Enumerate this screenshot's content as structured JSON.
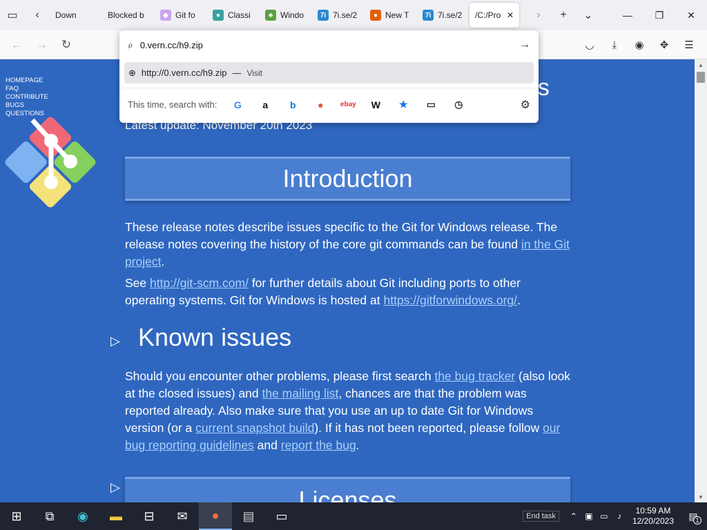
{
  "browser": {
    "tabs": [
      {
        "label": "Down",
        "fav": "",
        "fav_color": "#f0f0f4",
        "fav_text": ""
      },
      {
        "label": "Blocked b",
        "fav": "",
        "fav_color": "#f0f0f4",
        "fav_text": ""
      },
      {
        "label": "Git fo",
        "fav": "git-icon",
        "fav_color": "#c9a4f0",
        "fav_text": "◆"
      },
      {
        "label": "Classi",
        "fav": "globe-icon",
        "fav_color": "#3aa0a0",
        "fav_text": "●"
      },
      {
        "label": "Windo",
        "fav": "leaf-icon",
        "fav_color": "#5aa040",
        "fav_text": "♣"
      },
      {
        "label": "7i.se/2",
        "fav": "7i-icon",
        "fav_color": "#2a8ad0",
        "fav_text": "7i"
      },
      {
        "label": "New T",
        "fav": "firefox-icon",
        "fav_color": "#e0600a",
        "fav_text": "●"
      },
      {
        "label": "7i.se/2",
        "fav": "7i-icon",
        "fav_color": "#2a8ad0",
        "fav_text": "7i"
      },
      {
        "label": "/C:/Pro",
        "fav": "",
        "fav_color": "#ffffff",
        "fav_text": ""
      }
    ],
    "url_input": "0.vern.cc/h9.zip",
    "suggestion": {
      "url": "http://0.vern.cc/h9.zip",
      "sep": "—",
      "action": "Visit"
    },
    "search_with_label": "This time, search with:",
    "engines": [
      {
        "name": "google-icon",
        "glyph": "G",
        "color": "#4285f4"
      },
      {
        "name": "amazon-icon",
        "glyph": "a",
        "color": "#111111"
      },
      {
        "name": "bing-icon",
        "glyph": "b",
        "color": "#0f7bd6"
      },
      {
        "name": "duckduckgo-icon",
        "glyph": "●",
        "color": "#de5833"
      },
      {
        "name": "ebay-icon",
        "glyph": "ebay",
        "color": "#e53238"
      },
      {
        "name": "wikipedia-icon",
        "glyph": "W",
        "color": "#111111"
      },
      {
        "name": "bookmarks-icon",
        "glyph": "★",
        "color": "#1a73e8"
      },
      {
        "name": "tabs-icon",
        "glyph": "▭",
        "color": "#333333"
      },
      {
        "name": "history-icon",
        "glyph": "◷",
        "color": "#333333"
      }
    ]
  },
  "page": {
    "nav": [
      "HOMEPAGE",
      "FAQ",
      "CONTRIBUTE",
      "BUGS",
      "QUESTIONS"
    ],
    "heading_peek": "es",
    "updated": "Latest update: November 20th 2023",
    "intro_title": "Introduction",
    "intro_p1_a": "These release notes describe issues specific to the Git for Windows release. The release notes covering the history of the core git commands can be found ",
    "intro_p1_link": "in the Git project",
    "intro_p1_b": ".",
    "intro_p2_a": "See ",
    "intro_p2_link1": "http://git-scm.com/",
    "intro_p2_b": " for further details about Git including ports to other operating systems. Git for Windows is hosted at ",
    "intro_p2_link2": "https://gitforwindows.org/",
    "intro_p2_c": ".",
    "known_title": "Known issues",
    "known_a": "Should you encounter other problems, please first search ",
    "known_link1": "the bug tracker",
    "known_b": " (also look at the closed issues) and ",
    "known_link2": "the mailing list",
    "known_c": ", chances are that the problem was reported already. Also make sure that you use an up to date Git for Windows version (or a ",
    "known_link3": "current snapshot build",
    "known_d": "). If it has not been reported, please follow ",
    "known_link4": "our bug reporting guidelines",
    "known_e": " and ",
    "known_link5": "report the bug",
    "known_f": ".",
    "licenses_title": "Licenses"
  },
  "taskbar": {
    "time": "10:59 AM",
    "date": "12/20/2023",
    "end_task": "End task",
    "notif_count": "1"
  }
}
